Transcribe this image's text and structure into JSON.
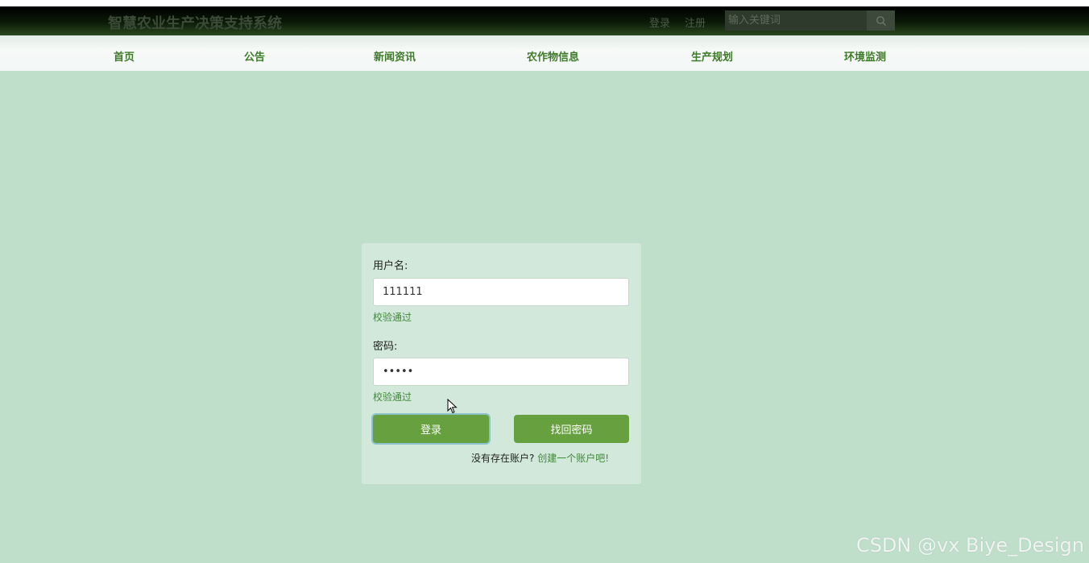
{
  "header": {
    "site_title": "智慧农业生产决策支持系统",
    "login_link": "登录",
    "register_link": "注册",
    "search_placeholder": "输入关键词",
    "search_icon": "search-icon"
  },
  "nav": {
    "items": [
      {
        "label": "首页"
      },
      {
        "label": "公告"
      },
      {
        "label": "新闻资讯"
      },
      {
        "label": "农作物信息"
      },
      {
        "label": "生产规划"
      },
      {
        "label": "环境监测"
      }
    ]
  },
  "login_form": {
    "username_label": "用户名:",
    "username_value": "111111",
    "username_status": "校验通过",
    "password_label": "密码:",
    "password_value": "•••••",
    "password_status": "校验通过",
    "login_button": "登录",
    "find_password_button": "找回密码",
    "no_account_text": "没有存在账户?",
    "create_account_link": "创建一个账户吧!"
  },
  "watermark": "CSDN @vx  Biye_Design",
  "colors": {
    "background": "#bfdfcb",
    "panel": "#d1e8da",
    "accent": "#67a03f",
    "nav_text": "#3d7a28",
    "valid_text": "#3f8a35"
  }
}
